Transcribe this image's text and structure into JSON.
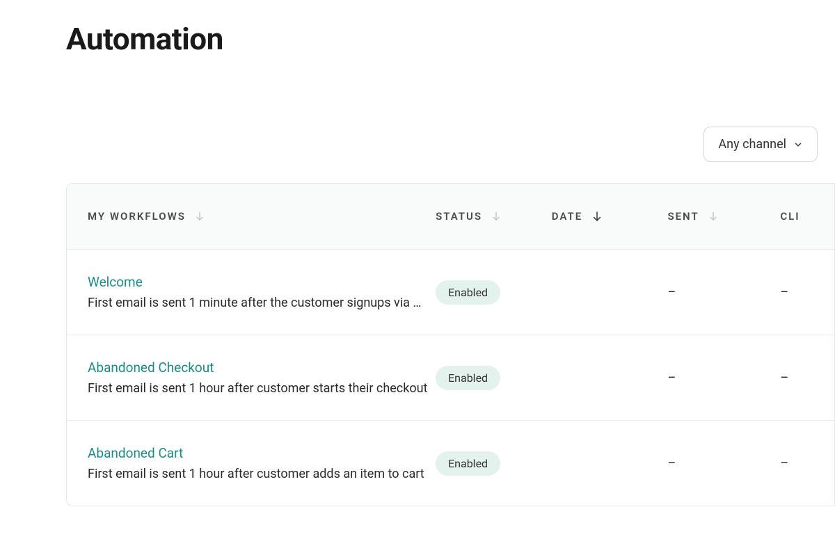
{
  "page": {
    "title": "Automation"
  },
  "filter": {
    "channel_label": "Any channel"
  },
  "columns": {
    "workflows": "MY WORKFLOWS",
    "status": "STATUS",
    "date": "DATE",
    "sent": "SENT",
    "click": "CLI"
  },
  "rows": [
    {
      "name": "Welcome",
      "description": "First email is sent 1 minute after the customer signups via …",
      "status": "Enabled",
      "date": "",
      "sent": "–",
      "click": "–"
    },
    {
      "name": "Abandoned Checkout",
      "description": "First email is sent 1 hour after customer starts their checkout",
      "status": "Enabled",
      "date": "",
      "sent": "–",
      "click": "–"
    },
    {
      "name": "Abandoned Cart",
      "description": "First email is sent 1 hour after customer adds an item to cart",
      "status": "Enabled",
      "date": "",
      "sent": "–",
      "click": "–"
    }
  ]
}
